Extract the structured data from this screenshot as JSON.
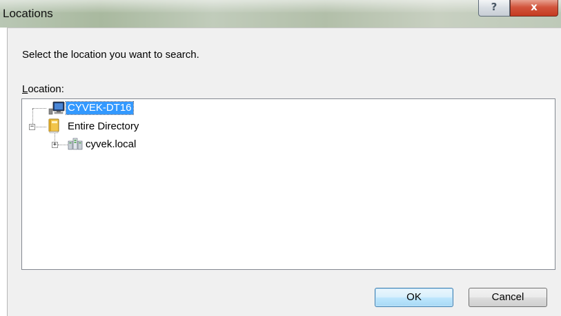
{
  "window": {
    "title": "Locations",
    "help_glyph": "?",
    "close_glyph": "x"
  },
  "instruction": "Select the location you want to search.",
  "location_label": {
    "mnemonic": "L",
    "rest": "ocation:"
  },
  "tree": {
    "items": [
      {
        "label": "CYVEK-DT16",
        "icon": "computer-icon",
        "selected": true
      },
      {
        "label": "Entire Directory",
        "icon": "directory-book-icon",
        "expander": "−"
      },
      {
        "label": "cyvek.local",
        "icon": "domain-icon",
        "expander": "+"
      }
    ]
  },
  "buttons": {
    "ok": "OK",
    "cancel": "Cancel"
  },
  "colors": {
    "selection": "#3399ff",
    "close_button": "#c43a20",
    "default_button_border": "#3c7fb1"
  }
}
